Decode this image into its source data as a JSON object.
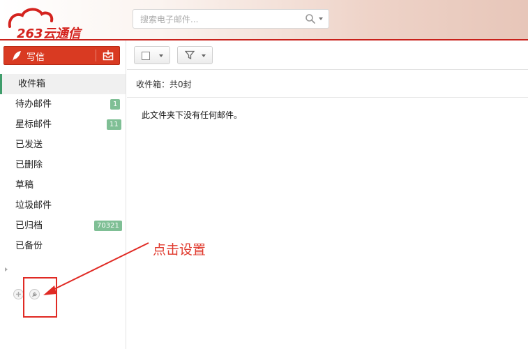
{
  "header": {
    "logo_text": "263云通信",
    "search_placeholder": "搜索电子邮件..."
  },
  "sidebar": {
    "compose_label": "写信",
    "folders": [
      {
        "label": "收件箱",
        "badge": ""
      },
      {
        "label": "待办邮件",
        "badge": "1"
      },
      {
        "label": "星标邮件",
        "badge": "11"
      },
      {
        "label": "已发送",
        "badge": ""
      },
      {
        "label": "已删除",
        "badge": ""
      },
      {
        "label": "草稿",
        "badge": ""
      },
      {
        "label": "垃圾邮件",
        "badge": ""
      },
      {
        "label": "已归档",
        "badge": "70321"
      },
      {
        "label": "已备份",
        "badge": ""
      }
    ]
  },
  "main": {
    "folder_summary": "收件箱：共0封",
    "empty_message": "此文件夹下没有任何邮件。"
  },
  "annotation": {
    "text": "点击设置"
  },
  "colors": {
    "brand_red": "#d93a22",
    "badge_green": "#7fbf95",
    "annotation_red": "#e03a2e"
  }
}
